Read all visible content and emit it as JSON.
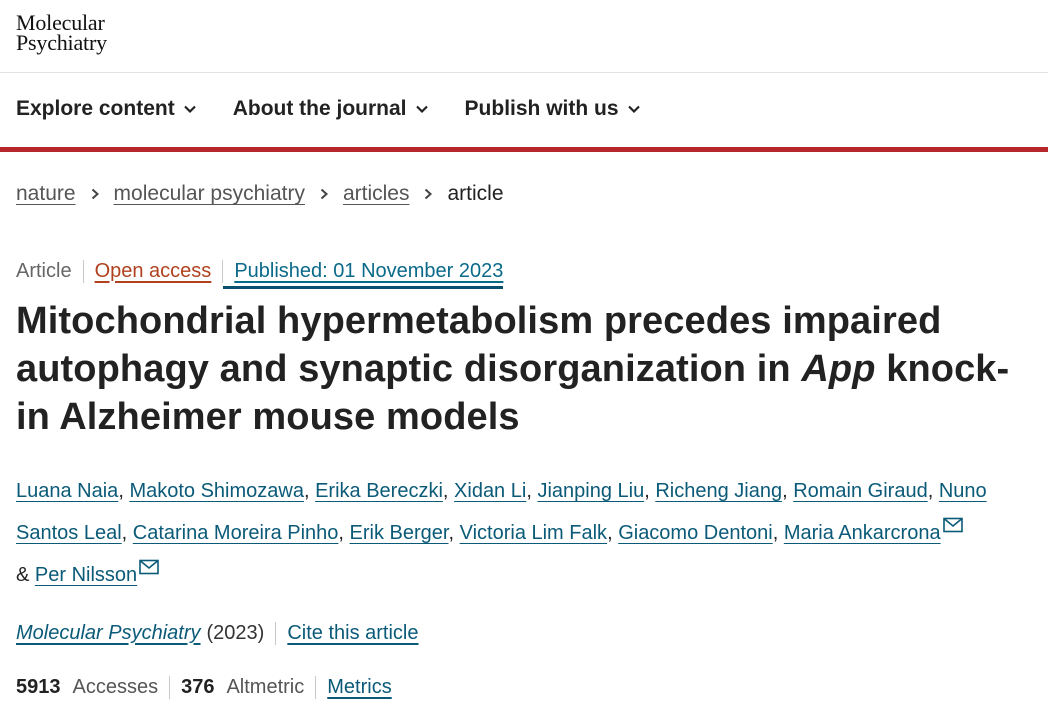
{
  "brand": {
    "line1": "Molecular",
    "line2": "Psychiatry"
  },
  "nav": {
    "items": [
      {
        "label": "Explore content"
      },
      {
        "label": "About the journal"
      },
      {
        "label": "Publish with us"
      }
    ]
  },
  "breadcrumb": {
    "items": [
      "nature",
      "molecular psychiatry",
      "articles"
    ],
    "current": "article"
  },
  "article_meta": {
    "type": "Article",
    "access": "Open access",
    "published": "Published: 01 November 2023"
  },
  "title": {
    "part1": "Mitochondrial hypermetabolism precedes impaired autophagy and synaptic disorganization in ",
    "italic": "App",
    "part2": " knock-in Alzheimer mouse models"
  },
  "authors": [
    "Luana Naia",
    "Makoto Shimozawa",
    "Erika Bereczki",
    "Xidan Li",
    "Jianping Liu",
    "Richeng Jiang",
    "Romain Giraud",
    "Nuno Santos Leal",
    "Catarina Moreira Pinho",
    "Erik Berger",
    "Victoria Lim Falk",
    "Giacomo Dentoni",
    "Maria Ankarcrona",
    "Per Nilsson"
  ],
  "authors_joiner": "&",
  "journal": {
    "name": "Molecular Psychiatry",
    "year": "(2023)",
    "cite_label": "Cite this article"
  },
  "metrics": {
    "accesses": "5913",
    "accesses_label": "Accesses",
    "altmetric": "376",
    "altmetric_label": "Altmetric",
    "metrics_link": "Metrics"
  },
  "colors": {
    "accent_red": "#b7262b",
    "link_blue": "#0a5a78",
    "open_access": "#b0411e"
  },
  "icons": {
    "nav_chevron": "chevron-down-icon",
    "breadcrumb_sep": "chevron-right-icon",
    "email": "email-icon"
  }
}
